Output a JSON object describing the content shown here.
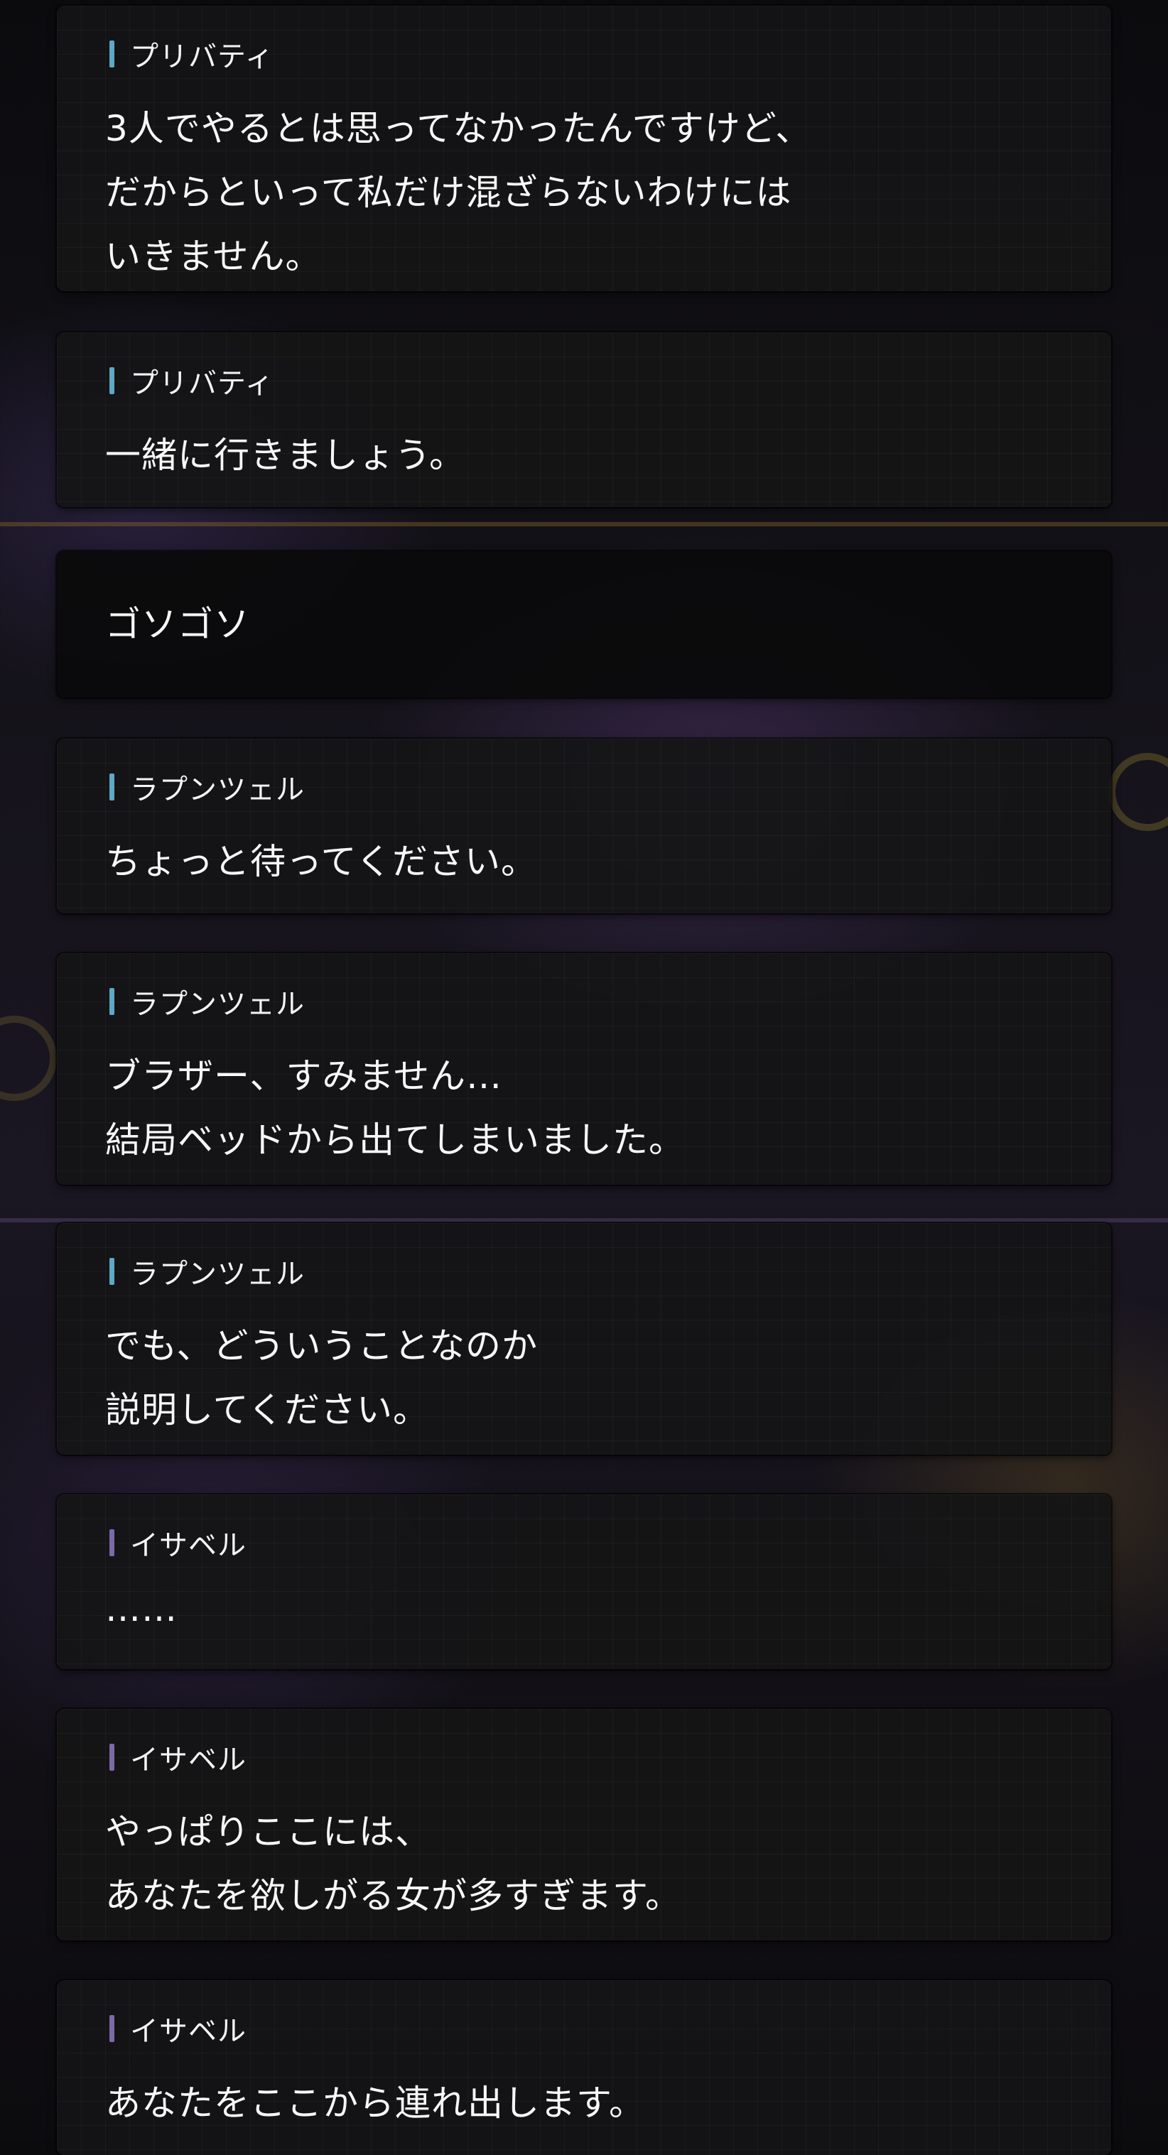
{
  "colors": {
    "bubble_background": "#141416",
    "narration_background": "#0a0a0b",
    "text": "#f7f7f7",
    "speaker_bar_blue": "#5fa8c4",
    "speaker_bar_purple": "#7c6aa6"
  },
  "messages": [
    {
      "speaker": "プリバティ",
      "bar_color": "#5fa8c4",
      "text": "3人でやるとは思ってなかったんですけど、\nだからといって私だけ混ざらないわけには\nいきません。"
    },
    {
      "speaker": "プリバティ",
      "bar_color": "#5fa8c4",
      "text": "一緒に行きましょう。"
    },
    {
      "speaker": "",
      "bar_color": "",
      "text": "ゴソゴソ"
    },
    {
      "speaker": "ラプンツェル",
      "bar_color": "#5fa8c4",
      "text": "ちょっと待ってください。"
    },
    {
      "speaker": "ラプンツェル",
      "bar_color": "#5fa8c4",
      "text": "ブラザー、すみません…\n結局ベッドから出てしまいました。"
    },
    {
      "speaker": "ラプンツェル",
      "bar_color": "#5fa8c4",
      "text": "でも、どういうことなのか\n説明してください。"
    },
    {
      "speaker": "イサベル",
      "bar_color": "#7c6aa6",
      "text": "……"
    },
    {
      "speaker": "イサベル",
      "bar_color": "#7c6aa6",
      "text": "やっぱりここには、\nあなたを欲しがる女が多すぎます。"
    },
    {
      "speaker": "イサベル",
      "bar_color": "#7c6aa6",
      "text": "あなたをここから連れ出します。"
    }
  ]
}
